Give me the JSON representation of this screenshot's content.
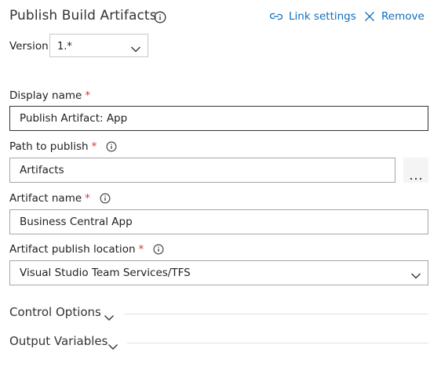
{
  "header": {
    "title": "Publish Build Artifacts",
    "link_settings_label": "Link settings",
    "remove_label": "Remove"
  },
  "version": {
    "label": "Version",
    "value": "1.*"
  },
  "fields": {
    "display_name": {
      "label": "Display name",
      "required_mark": "*",
      "value": "Publish Artifact: App"
    },
    "path_to_publish": {
      "label": "Path to publish",
      "required_mark": "*",
      "value": "Artifacts",
      "browse_label": "⋯"
    },
    "artifact_name": {
      "label": "Artifact name",
      "required_mark": "*",
      "value": "Business Central App"
    },
    "artifact_publish_location": {
      "label": "Artifact publish location",
      "required_mark": "*",
      "value": "Visual Studio Team Services/TFS"
    }
  },
  "sections": {
    "control_options": "Control Options",
    "output_variables": "Output Variables"
  },
  "colors": {
    "accent": "#106ebe",
    "required": "#d13438",
    "text": "#212121",
    "border": "#a6a6a6"
  },
  "icons": {
    "title_info": "info-icon",
    "link_settings": "link-icon",
    "remove": "close-icon",
    "dropdown": "chevron-down-icon",
    "browse": "ellipsis-icon"
  }
}
